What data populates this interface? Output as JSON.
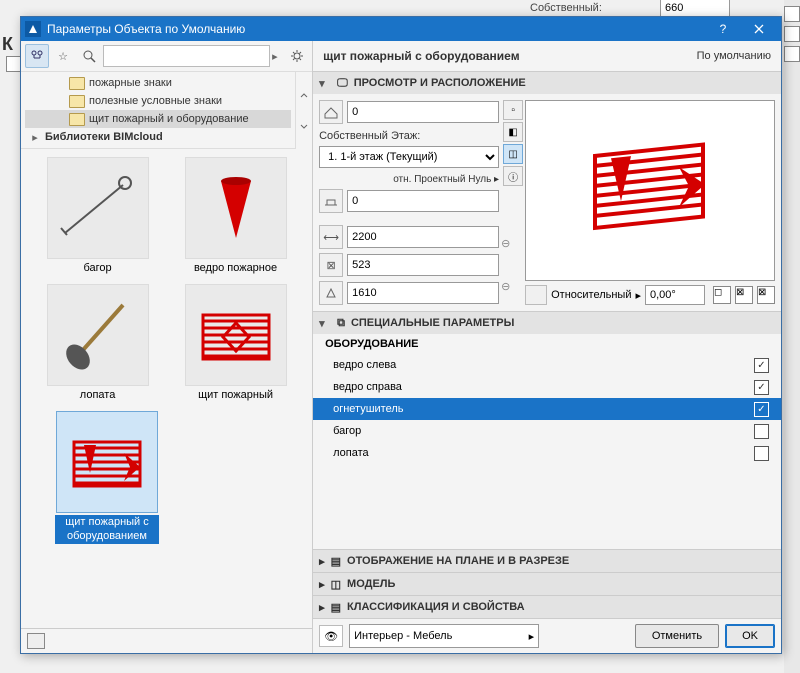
{
  "bg": {
    "label": "Собственный:",
    "value": "660"
  },
  "dialog": {
    "title": "Параметры Объекта по Умолчанию",
    "object_name": "щит пожарный с оборудованием",
    "default_link": "По умолчанию"
  },
  "search": {
    "placeholder": ""
  },
  "tree": {
    "items": [
      {
        "label": "пожарные знаки",
        "indent": 2,
        "sel": false
      },
      {
        "label": "полезные условные знаки",
        "indent": 2,
        "sel": false
      },
      {
        "label": "щит пожарный и оборудование",
        "indent": 2,
        "sel": true
      }
    ],
    "group": "Библиотеки BIMcloud"
  },
  "thumbs": [
    {
      "label": "багор",
      "sel": false,
      "kind": "bagor"
    },
    {
      "label": "ведро пожарное",
      "sel": false,
      "kind": "vedro"
    },
    {
      "label": "лопата",
      "sel": false,
      "kind": "lopata"
    },
    {
      "label": "щит пожарный",
      "sel": false,
      "kind": "shield"
    },
    {
      "label": "щит пожарный с оборудованием",
      "sel": true,
      "kind": "shieldeq"
    }
  ],
  "sections": {
    "preview": "ПРОСМОТР И РАСПОЛОЖЕНИЕ",
    "special": "СПЕЦИАЛЬНЫЕ ПАРАМЕТРЫ",
    "display": "ОТОБРАЖЕНИЕ НА ПЛАНЕ И В РАЗРЕЗЕ",
    "model": "МОДЕЛЬ",
    "classif": "КЛАССИФИКАЦИЯ И СВОЙСТВА"
  },
  "position": {
    "top_value": "0",
    "floor_label": "Собственный Этаж:",
    "floor_value": "1. 1-й этаж (Текущий)",
    "proj_null": "отн. Проектный Нуль",
    "z_value": "0",
    "w_value": "2200",
    "d_value": "523",
    "h_value": "1610",
    "angle_label": "Относительный",
    "angle_value": "0,00°"
  },
  "params": {
    "group": "ОБОРУДОВАНИЕ",
    "rows": [
      {
        "label": "ведро слева",
        "checked": true,
        "sel": false
      },
      {
        "label": "ведро справа",
        "checked": true,
        "sel": false
      },
      {
        "label": "огнетушитель",
        "checked": true,
        "sel": true
      },
      {
        "label": "багор",
        "checked": false,
        "sel": false
      },
      {
        "label": "лопата",
        "checked": false,
        "sel": false
      }
    ]
  },
  "footer": {
    "layer": "Интерьер - Мебель",
    "cancel": "Отменить",
    "ok": "OK"
  }
}
